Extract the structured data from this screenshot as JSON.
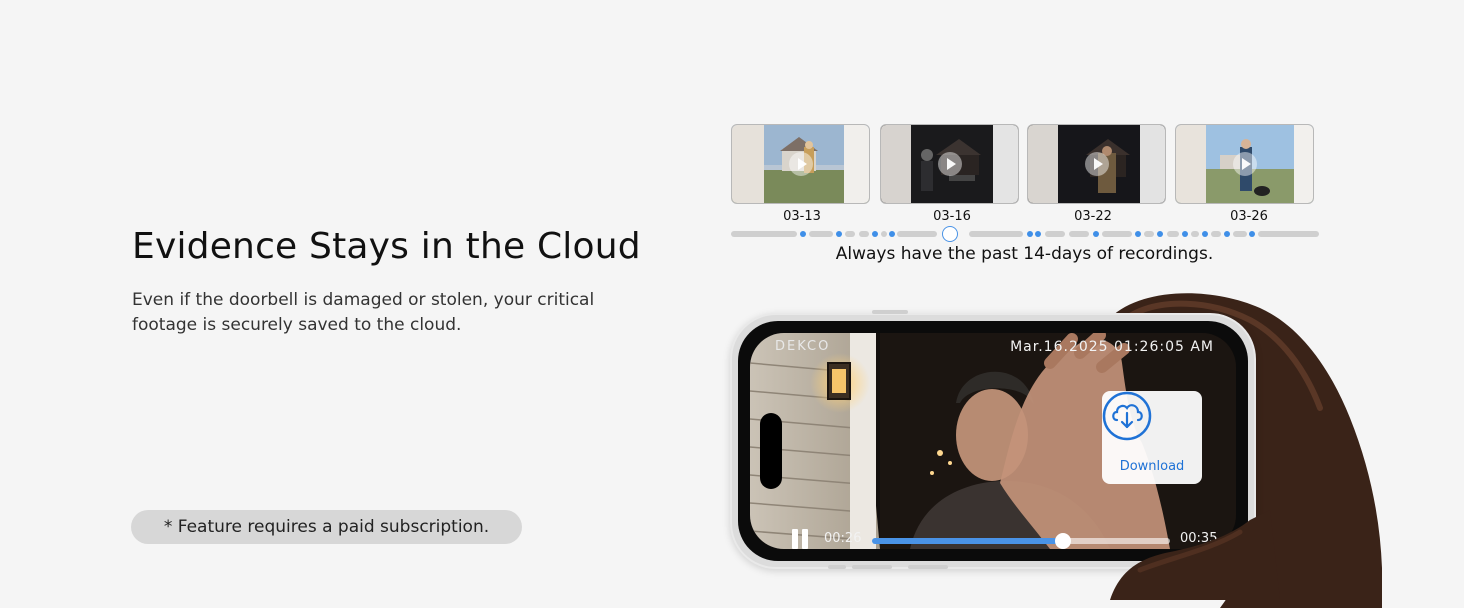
{
  "headline": "Evidence Stays in the Cloud",
  "description": "Even if the doorbell is damaged or stolen, your critical footage is securely saved to the cloud.",
  "note": "* Feature requires a paid subscription.",
  "recordings": {
    "dates": [
      "03-13",
      "03-16",
      "03-22",
      "03-26"
    ],
    "caption": "Always have the past 14-days of recordings."
  },
  "phone": {
    "brand": "DEKCO",
    "timestamp": "Mar.16.2025 01:26:05 AM",
    "download_label": "Download",
    "current_time": "00:26",
    "total_time": "00:35",
    "progress": 0.64,
    "icons": {
      "download": "cloud-download-icon",
      "pause": "pause-icon"
    },
    "accent": "#4a93e6"
  }
}
